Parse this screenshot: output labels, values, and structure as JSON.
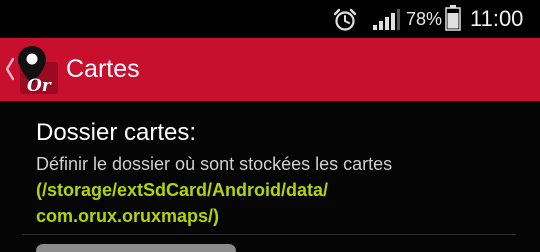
{
  "status_bar": {
    "battery_percent": "78%",
    "time": "11:00",
    "icons": [
      "alarm-icon",
      "signal-icon",
      "battery-icon"
    ]
  },
  "action_bar": {
    "title": "Cartes",
    "logo_text": "Or",
    "background_color": "#c8102e"
  },
  "preference": {
    "title": "Dossier cartes:",
    "summary": "Définir le dossier où sont stockées les cartes",
    "path": "(/storage/extSdCard/Android/data/ com.orux.oruxmaps/)",
    "path_color": "#b4d400"
  }
}
